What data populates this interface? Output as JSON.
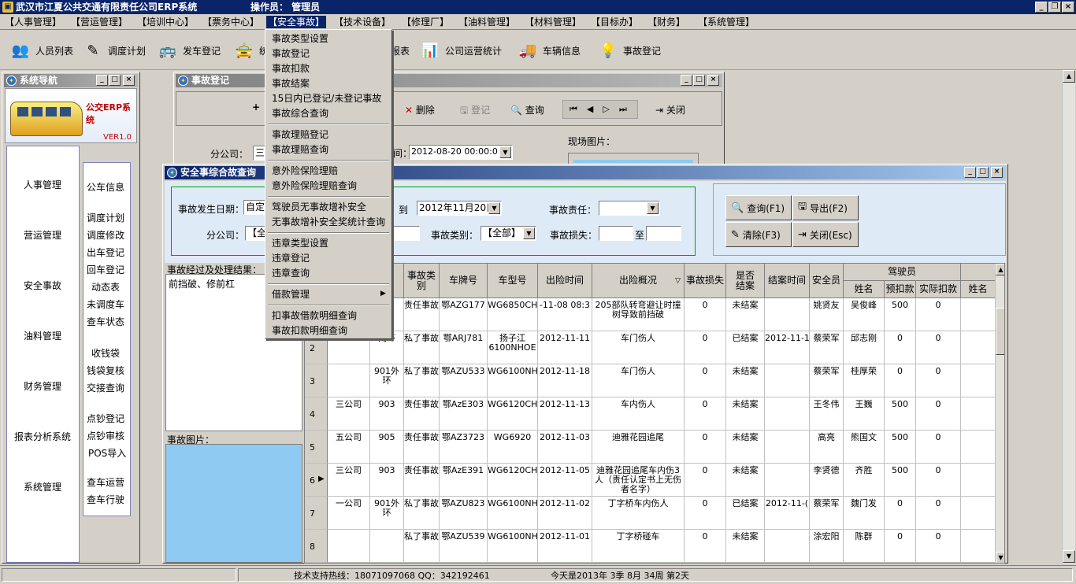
{
  "app": {
    "title": "武汉市江夏公共交通有限责任公司ERP系统",
    "operator": "操作员： 管理员"
  },
  "menu": [
    "【人事管理】",
    "【营运管理】",
    "【培训中心】",
    "【票务中心】",
    "【安全事故】",
    "【技术设备】",
    "【修理厂】",
    "【油料管理】",
    "【材料管理】",
    "【目标办】",
    "【财务】",
    "【系统管理】"
  ],
  "toolbar": {
    "t1": "人员列表",
    "t2": "调度计划",
    "t3": "发车登记",
    "t4": "统",
    "t5": "报表",
    "t6": "公司运营统计",
    "t7": "车辆信息",
    "t8": "事故登记"
  },
  "dropdown": [
    "事故类型设置",
    "事故登记",
    "事故扣款",
    "事故结案",
    "15日内已登记/未登记事故",
    "事故综合查询",
    "事故理赔登记",
    "事故理赔查询",
    "意外险保险理赔",
    "意外险保险理赔查询",
    "驾驶员无事故增补安全",
    "无事故增补安全奖统计查询",
    "违章类型设置",
    "违章登记",
    "违章查询",
    "借款管理",
    "扣事故借款明细查询",
    "事故扣款明细查询"
  ],
  "nav": {
    "title": "系统导航",
    "logo_brand": "公交ERP系统",
    "logo_ver": "VER1.0",
    "left": [
      "人事管理",
      "营运管理",
      "安全事故",
      "油料管理",
      "财务管理",
      "报表分析系统",
      "系统管理"
    ],
    "right": [
      "公车信息",
      "调度计划",
      "调度修改",
      "出车登记",
      "回车登记",
      "动态表",
      "未调度车",
      "查车状态",
      "收钱袋",
      "钱袋复核",
      "交接查询",
      "点钞登记",
      "点钞审核",
      "POS导入",
      "查车运营",
      "查车行驶"
    ]
  },
  "reg": {
    "title": "事故登记",
    "tb": [
      "删除",
      "登记",
      "查询",
      "关闭"
    ],
    "branch_label": "分公司：",
    "branch": "三",
    "time_label": "间：",
    "time": "2012-08-20 00:00:0",
    "photo_label": "现场图片："
  },
  "q": {
    "title": "安全事综合故查询",
    "date_label": "事故发生日期：",
    "date_mode": "自定",
    "to_label": "到",
    "date_to": "2012年11月20日",
    "resp_label": "事故责任：",
    "resp": "",
    "branch_label": "分公司：",
    "branch": "【全",
    "type_label": "事故类别：",
    "type": "【全部】",
    "loss_label": "事故损失：",
    "loss_to": "至",
    "btn_query": "查询(F1)",
    "btn_export": "导出(F2)",
    "btn_clear": "清除(F3)",
    "btn_close": "关闭(Esc)",
    "process_label": "事故经过及处理结果：",
    "process_text": "前挡破、修前杠",
    "image_label": "事故图片："
  },
  "grid": {
    "headers": [
      "名",
      "事故类别",
      "车牌号",
      "车型号",
      "出险时间",
      "出险概况",
      "事故损失",
      "是否结案",
      "结案时间",
      "安全员",
      "驾驶员",
      "姓名",
      "预扣款",
      "实际扣款",
      "姓名"
    ],
    "sort_mark": "▽",
    "rows": [
      {
        "n": "",
        "co": "",
        "ro": "",
        "type": "责任事故",
        "plate": "鄂AZG177",
        "model": "WG6850CHK",
        "time": "-11-08 08:3",
        "desc": "205部队转弯避让时撞树导致前挡破",
        "loss": "0",
        "closed": "未结案",
        "ctime": "",
        "safety": "姚贤友",
        "driver": "吴俊峰",
        "pre": "500",
        "act": "0"
      },
      {
        "n": "2",
        "co": "",
        "ro": "内环",
        "type": "私了事故",
        "plate": "鄂ARJ781",
        "model": "扬子江6100NHOE",
        "time": "2012-11-11",
        "desc": "车门伤人",
        "loss": "0",
        "closed": "已结案",
        "ctime": "2012-11-1",
        "safety": "蔡荣军",
        "driver": "邱志刚",
        "pre": "0",
        "act": "0"
      },
      {
        "n": "3",
        "co": "",
        "ro": "901外环",
        "type": "私了事故",
        "plate": "鄂AZU533",
        "model": "WG6100NHA",
        "time": "2012-11-18",
        "desc": "车门伤人",
        "loss": "0",
        "closed": "未结案",
        "ctime": "",
        "safety": "蔡荣军",
        "driver": "桂厚荣",
        "pre": "0",
        "act": "0"
      },
      {
        "n": "4",
        "co": "三公司",
        "ro": "903",
        "type": "责任事故",
        "plate": "鄂AzE303",
        "model": "WG6120CHA",
        "time": "2012-11-13",
        "desc": "车内伤人",
        "loss": "0",
        "closed": "未结案",
        "ctime": "",
        "safety": "王冬伟",
        "driver": "王巍",
        "pre": "500",
        "act": "0"
      },
      {
        "n": "5",
        "co": "五公司",
        "ro": "905",
        "type": "责任事故",
        "plate": "鄂AZ3723",
        "model": "WG6920",
        "time": "2012-11-03",
        "desc": "迪雅花园追尾",
        "loss": "0",
        "closed": "未结案",
        "ctime": "",
        "safety": "高亮",
        "driver": "熊国文",
        "pre": "500",
        "act": "0"
      },
      {
        "n": "6",
        "co": "三公司",
        "ro": "903",
        "type": "责任事故",
        "plate": "鄂AzE391",
        "model": "WG6120CHA",
        "time": "2012-11-05",
        "desc": "迪雅花园追尾车内伤3人（责任认定书上无伤者名字）",
        "loss": "0",
        "closed": "未结案",
        "ctime": "",
        "safety": "李贤德",
        "driver": "齐胜",
        "pre": "500",
        "act": "0"
      },
      {
        "n": "7",
        "co": "一公司",
        "ro": "901外环",
        "type": "私了事故",
        "plate": "鄂AZU823",
        "model": "WG6100NHA",
        "time": "2012-11-02",
        "desc": "丁字桥车内伤人",
        "loss": "0",
        "closed": "已结案",
        "ctime": "2012-11-(",
        "safety": "蔡荣军",
        "driver": "魏门发",
        "pre": "0",
        "act": "0"
      },
      {
        "n": "8",
        "co": "",
        "ro": "",
        "type": "私了事故",
        "plate": "鄂AZU539",
        "model": "WG6100NHA",
        "time": "2012-11-01",
        "desc": "丁字桥碰车",
        "loss": "0",
        "closed": "未结案",
        "ctime": "",
        "safety": "涂宏阳",
        "driver": "陈群",
        "pre": "0",
        "act": "0"
      }
    ]
  },
  "status": {
    "hotline": "技术支持热线：18071097068  QQ：342192461",
    "today": "今天是2013年 3季 8月 34周 第2天"
  }
}
